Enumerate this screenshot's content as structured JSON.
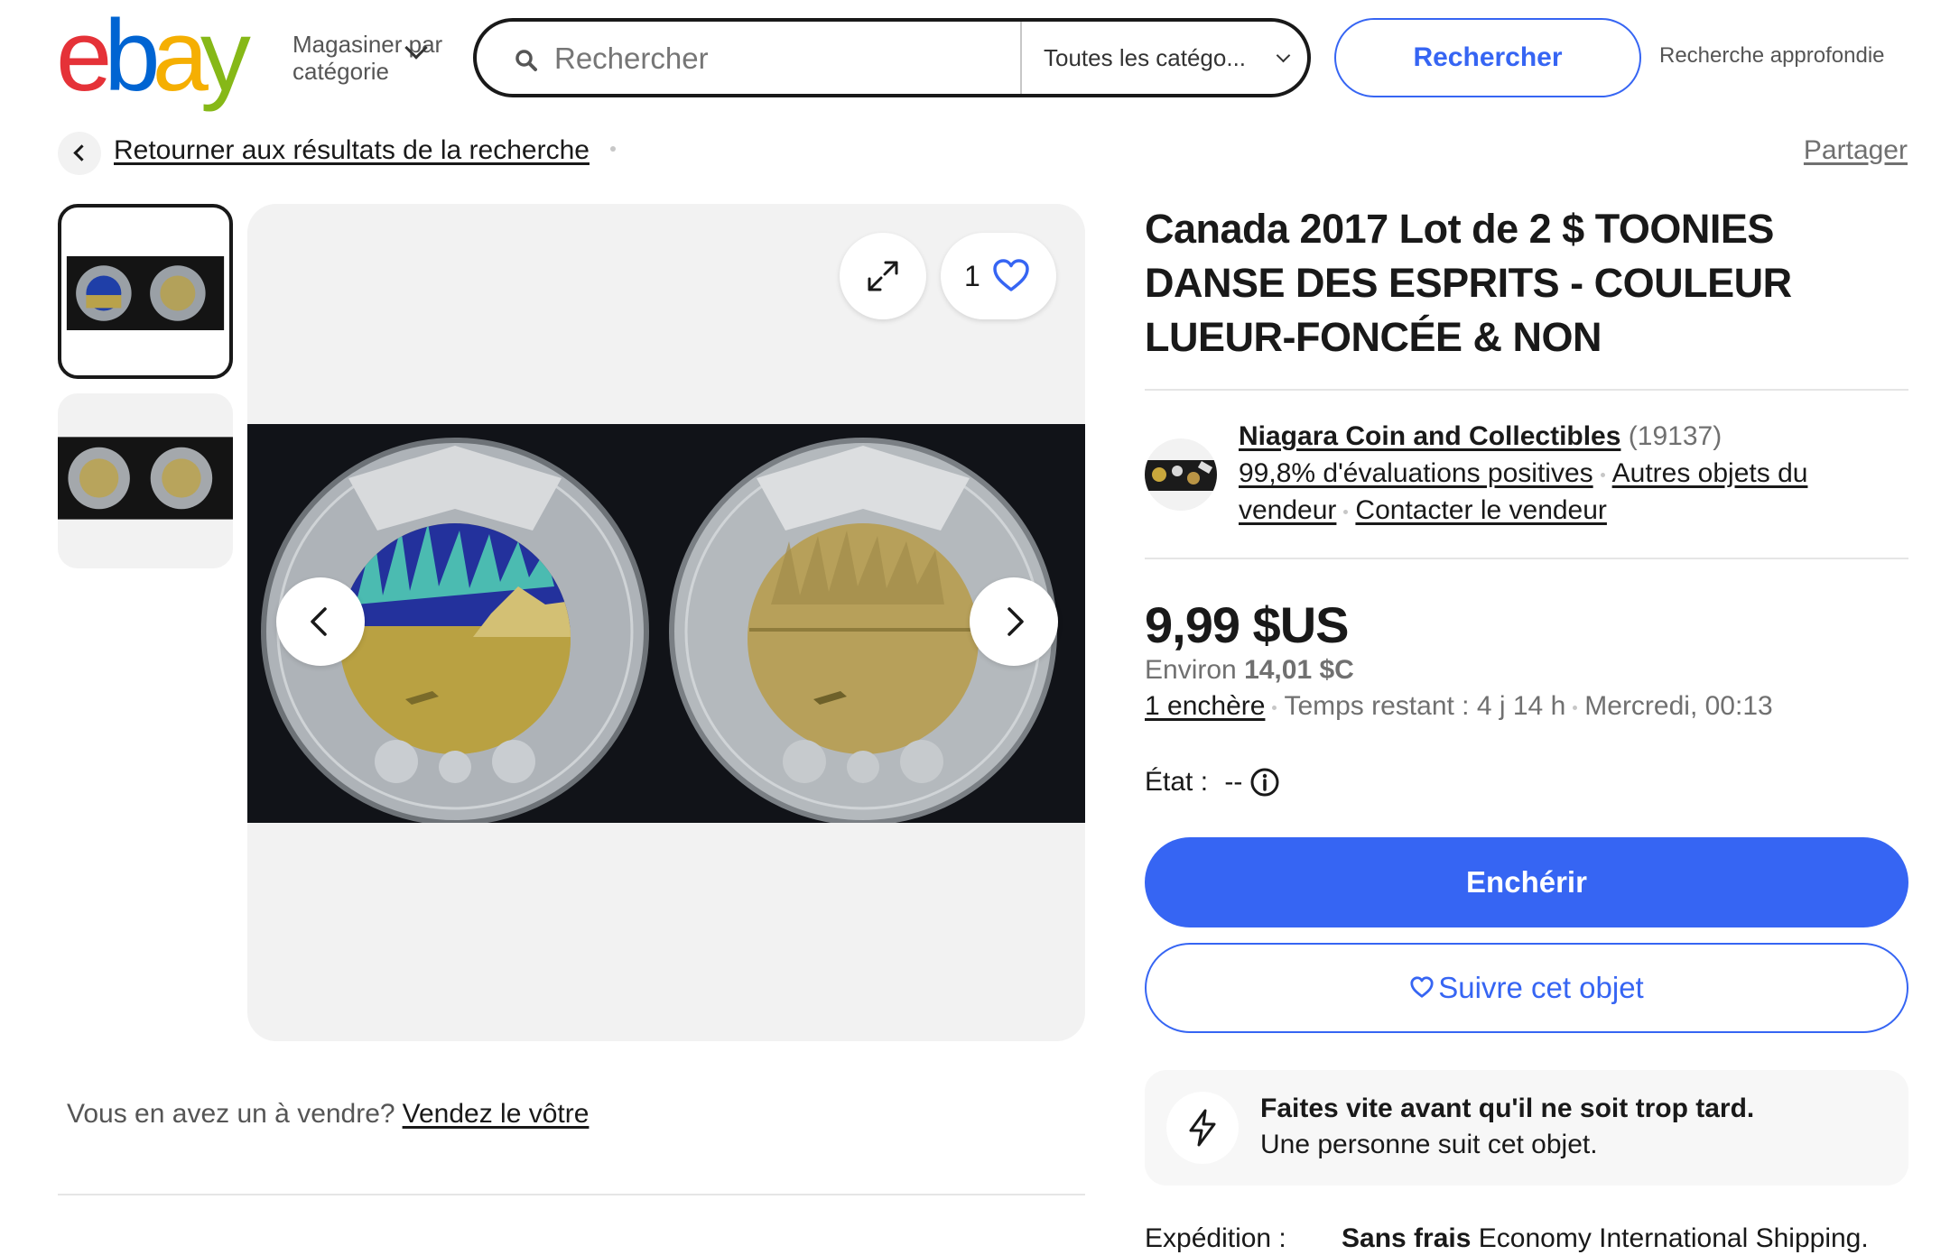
{
  "header": {
    "logo_letters": [
      "e",
      "b",
      "a",
      "y"
    ],
    "shop_by_category": "Magasiner par catégorie",
    "search": {
      "placeholder": "Rechercher",
      "value": ""
    },
    "category_select": "Toutes les catégo...",
    "search_button": "Rechercher",
    "advanced_search": "Recherche approfondie"
  },
  "breadcrumb": {
    "back_link": "Retourner aux résultats de la recherche",
    "share": "Partager"
  },
  "gallery": {
    "like_count": "1",
    "thumbnails": [
      "thumbnail-1",
      "thumbnail-2"
    ],
    "selected_thumbnail": 1
  },
  "sell": {
    "prompt": "Vous en avez un à vendre?",
    "link": "Vendez le vôtre"
  },
  "listing": {
    "title": "Canada 2017 Lot de 2 $ TOONIES DANSE DES ESPRITS - COULEUR LUEUR-FONCÉE & NON",
    "seller": {
      "name": "Niagara Coin and Collectibles",
      "feedback_count": "(19137)",
      "positive": "99,8% d'évaluations positives",
      "other_items": "Autres objets du vendeur",
      "contact": "Contacter le vendeur"
    },
    "price": "9,99 $US",
    "approx_prefix": "Environ",
    "approx_value": "14,01 $C",
    "bids": "1 enchère",
    "time_left": "Temps restant : 4 j 14 h",
    "end_time": "Mercredi, 00:13",
    "condition_label": "État :",
    "condition_value": "--",
    "bid_button": "Enchérir",
    "watch_button": "Suivre cet objet",
    "urgency": {
      "line1": "Faites vite avant qu'il ne soit trop tard.",
      "line2": "Une personne suit cet objet."
    },
    "shipping": {
      "label": "Expédition :",
      "free": "Sans frais",
      "method": "Economy International Shipping."
    }
  },
  "colors": {
    "accent": "#3665f3",
    "text": "#191919",
    "muted": "#707070",
    "logo_e": "#e53238",
    "logo_b": "#0064d2",
    "logo_a": "#f5af02",
    "logo_y": "#86b817"
  }
}
